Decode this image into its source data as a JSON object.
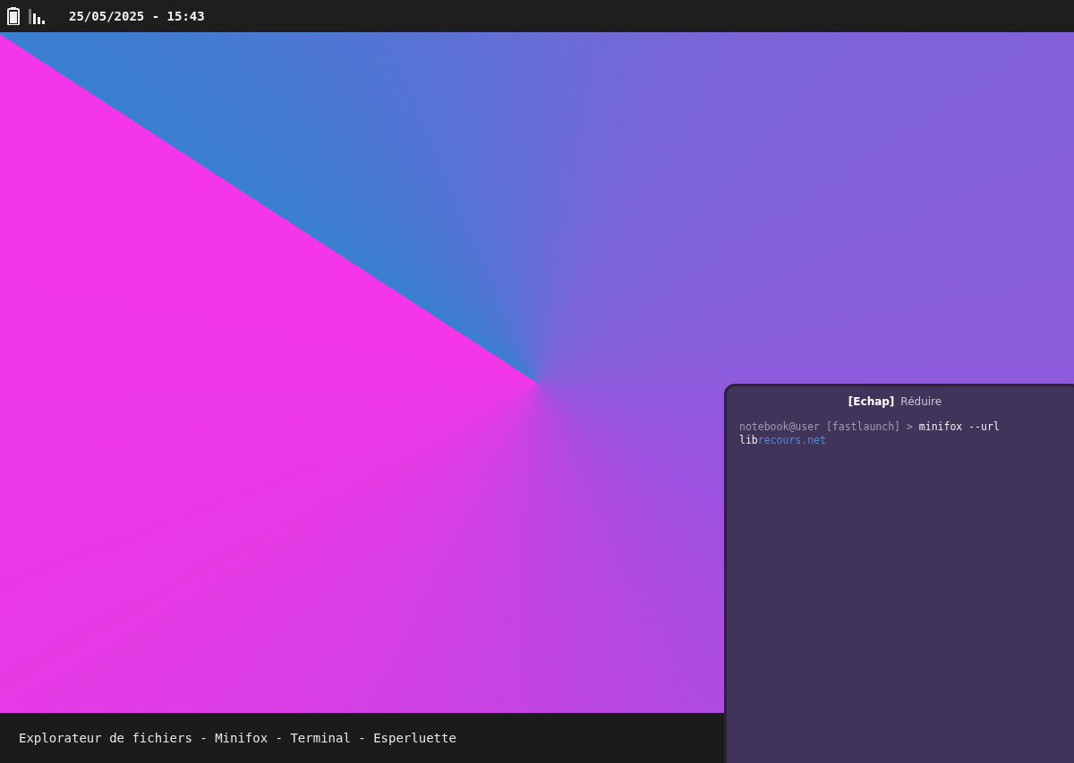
{
  "top_bar": {
    "datetime": "25/05/2025 - 15:43"
  },
  "terminal": {
    "hint_key": "[Echap]",
    "hint_label": "Réduire",
    "lines": [
      [
        {
          "kind": "prompt",
          "text": "notebook@user [fastlaunch] > "
        },
        {
          "kind": "command",
          "text": "minifox --url"
        }
      ],
      [
        {
          "kind": "command",
          "text": "lib"
        },
        {
          "kind": "link",
          "text": "recours.net"
        }
      ]
    ]
  },
  "taskbar": {
    "text": "Explorateur de fichiers - Minifox - Terminal - Esperluette"
  }
}
